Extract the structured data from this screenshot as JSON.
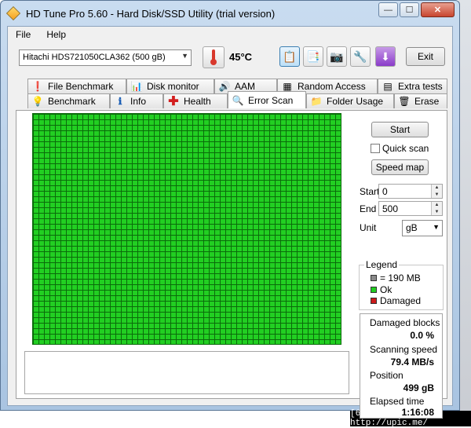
{
  "window": {
    "title": "HD Tune Pro 5.60 - Hard Disk/SSD Utility (trial version)",
    "min_label": "—",
    "max_label": "☐",
    "close_label": "✕"
  },
  "menu": {
    "file_label": "File",
    "help_label": "Help"
  },
  "toolbar": {
    "drive": "Hitachi HDS721050CLA362 (500 gB)",
    "temperature": "45°C",
    "exit_label": "Exit"
  },
  "tabs": {
    "top": [
      "File Benchmark",
      "Disk monitor",
      "AAM",
      "Random Access",
      "Extra tests"
    ],
    "bottom": [
      "Benchmark",
      "Info",
      "Health",
      "Error Scan",
      "Folder Usage",
      "Erase"
    ],
    "active": "Error Scan"
  },
  "scan": {
    "start_label": "Start",
    "quick_scan_label": "Quick scan",
    "speed_map_label": "Speed map",
    "start_field_label": "Start",
    "start_value": "0",
    "end_field_label": "End",
    "end_value": "500",
    "unit_label": "Unit",
    "unit_value": "gB"
  },
  "legend": {
    "title": "Legend",
    "items": [
      {
        "label": "= 190 MB",
        "color": "#8a8a8a"
      },
      {
        "label": "Ok",
        "color": "#22cc22"
      },
      {
        "label": "Damaged",
        "color": "#cc1a1a"
      }
    ]
  },
  "stats": {
    "damaged_label": "Damaged blocks",
    "damaged_value": "0.0 %",
    "speed_label": "Scanning speed",
    "speed_value": "79.4 MB/s",
    "position_label": "Position",
    "position_value": "499 gB",
    "elapsed_label": "Elapsed time",
    "elapsed_value": "1:16:08"
  },
  "watermark": "[609x532] http://upic.me/",
  "colors": {
    "block_ok": "#22cf22",
    "grid_line": "#0b6b0b"
  }
}
